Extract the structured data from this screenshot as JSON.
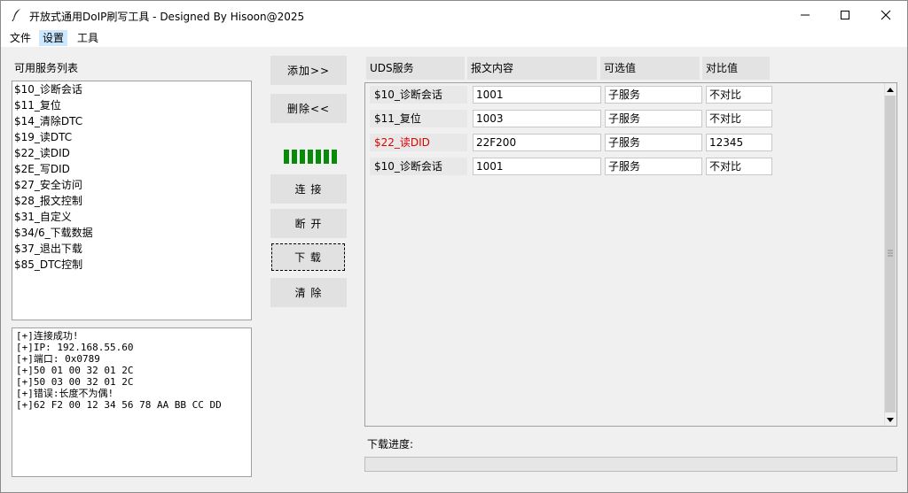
{
  "window": {
    "title": "开放式通用DoIP刷写工具 - Designed By Hisoon@2025",
    "controls": {
      "minimize": "minimize",
      "maximize": "maximize",
      "close": "close"
    }
  },
  "menu": [
    "文件",
    "设置",
    "工具"
  ],
  "left": {
    "list_title": "可用服务列表",
    "services": [
      "$10_诊断会话",
      "$11_复位",
      "$14_清除DTC",
      "$19_读DTC",
      "$22_读DID",
      "$2E_写DID",
      "$27_安全访问",
      "$28_报文控制",
      "$31_自定义",
      "$34/6_下载数据",
      "$37_退出下载",
      "$85_DTC控制"
    ],
    "log": [
      "[+]连接成功!",
      "[+]IP: 192.168.55.60",
      "[+]端口: 0x0789",
      "[+]50 01 00 32 01 2C",
      "[+]50 03 00 32 01 2C",
      "[+]错误:长度不为偶!",
      "[+]62 F2 00 12 34 56 78 AA BB CC DD"
    ]
  },
  "buttons": {
    "add": "添加>>",
    "remove": "删除<<",
    "connect": "连 接",
    "disconnect": "断 开",
    "download": "下 载",
    "clear": "清 除"
  },
  "indicator": {
    "segments": 7,
    "color": "#0a8a0a"
  },
  "table": {
    "headers": [
      "UDS服务",
      "报文内容",
      "可选值",
      "对比值"
    ],
    "rows": [
      {
        "service": "$10_诊断会话",
        "content": "1001",
        "option": "子服务",
        "compare": "不对比",
        "highlight": false
      },
      {
        "service": "$11_复位",
        "content": "1003",
        "option": "子服务",
        "compare": "不对比",
        "highlight": false
      },
      {
        "service": "$22_读DID",
        "content": "22F200",
        "option": "子服务",
        "compare": "12345",
        "highlight": true
      },
      {
        "service": "$10_诊断会话",
        "content": "1001",
        "option": "子服务",
        "compare": "不对比",
        "highlight": false
      }
    ],
    "highlight_color": "#e00000"
  },
  "download": {
    "label": "下载进度:",
    "progress": 0
  }
}
